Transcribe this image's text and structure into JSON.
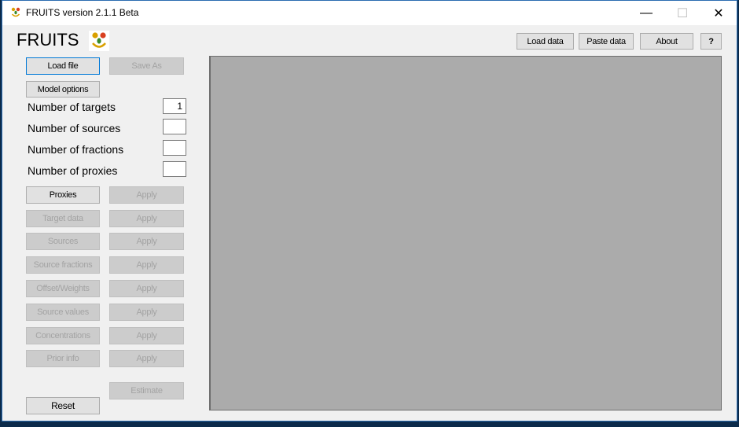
{
  "window": {
    "title": "FRUITS version 2.1.1 Beta",
    "controls": {
      "minimize": "—",
      "maximize": "☐",
      "close": "✕"
    }
  },
  "header": {
    "app_name": "FRUITS",
    "logo_icon": "fruits-face-logo",
    "buttons": {
      "load_data": "Load data",
      "paste_data": "Paste data",
      "about": "About",
      "help": "?"
    }
  },
  "sidebar": {
    "load_file": "Load file",
    "save_as": "Save As",
    "model_options": "Model options",
    "fields": [
      {
        "label": "Number of targets",
        "value": "1"
      },
      {
        "label": "Number of sources",
        "value": ""
      },
      {
        "label": "Number of fractions",
        "value": ""
      },
      {
        "label": "Number of proxies",
        "value": ""
      }
    ],
    "steps": [
      {
        "label": "Proxies",
        "apply": "Apply",
        "enabled": true
      },
      {
        "label": "Target data",
        "apply": "Apply",
        "enabled": false
      },
      {
        "label": "Sources",
        "apply": "Apply",
        "enabled": false
      },
      {
        "label": "Source fractions",
        "apply": "Apply",
        "enabled": false
      },
      {
        "label": "Offset/Weights",
        "apply": "Apply",
        "enabled": false
      },
      {
        "label": "Source values",
        "apply": "Apply",
        "enabled": false
      },
      {
        "label": "Concentrations",
        "apply": "Apply",
        "enabled": false
      },
      {
        "label": "Prior info",
        "apply": "Apply",
        "enabled": false
      }
    ],
    "estimate": "Estimate",
    "reset": "Reset"
  }
}
